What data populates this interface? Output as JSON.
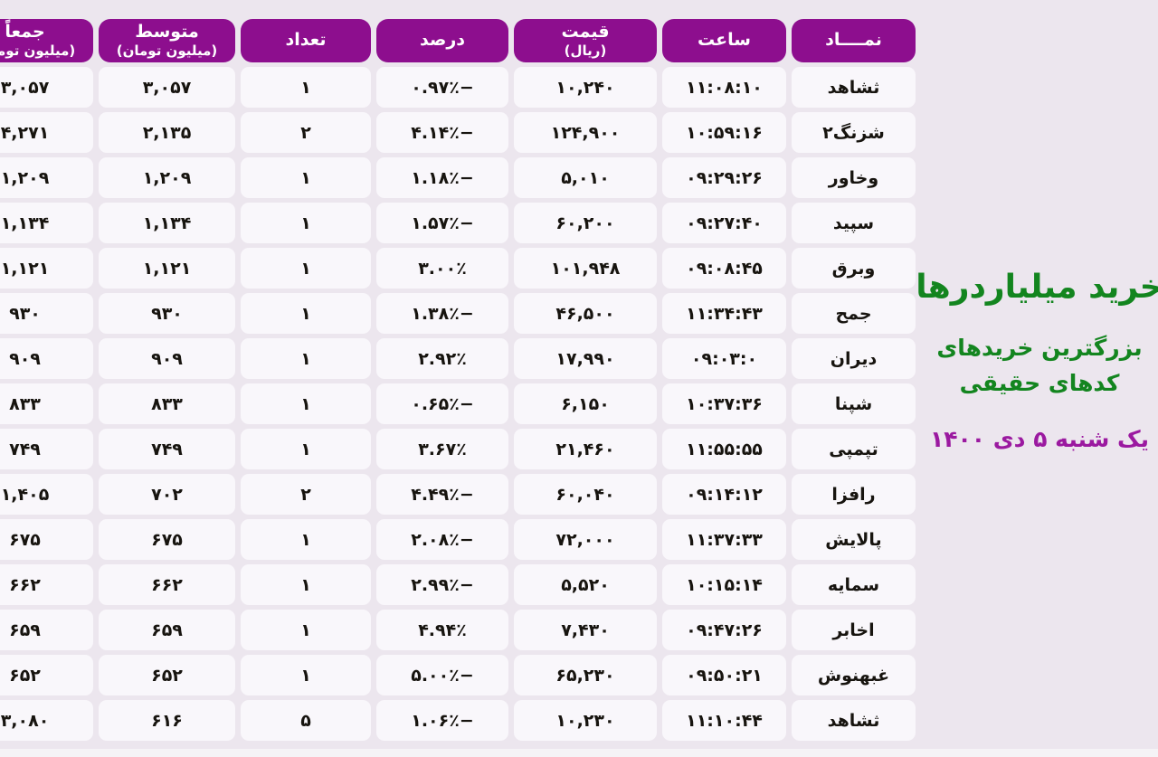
{
  "caption": {
    "title": "خرید میلیاردرها",
    "subtitle_line1": "بزرگترین خریدهای",
    "subtitle_line2": "کدهای حقیقی",
    "date": "یک شنبه ۵ دی ۱۴۰۰",
    "title_color": "#13851f",
    "subtitle_color": "#13851f",
    "date_color": "#9b19a0"
  },
  "theme": {
    "page_background": "#ece6ee",
    "header_background": "#8d0e8e",
    "header_text": "#ffffff",
    "cell_background": "#f9f7fb",
    "cell_text": "#17140f",
    "positive_color": "#17761d",
    "negative_color": "#e01b1b"
  },
  "table": {
    "headers": [
      {
        "main": "نمــــاد",
        "unit": ""
      },
      {
        "main": "ساعت",
        "unit": ""
      },
      {
        "main": "قیمت",
        "unit": "(ریال)"
      },
      {
        "main": "درصد",
        "unit": ""
      },
      {
        "main": "تعداد",
        "unit": ""
      },
      {
        "main": "متوسط",
        "unit": "(میلیون تومان)"
      },
      {
        "main": "جمعاً",
        "unit": "(میلیون تومان)"
      }
    ],
    "rows": [
      {
        "symbol": "ثشاهد",
        "time": "۱۱:۰۸:۱۰",
        "price": "۱۰,۲۴۰",
        "percent": "−۰.۹۷٪",
        "sign": "neg",
        "count": "۱",
        "average": "۳,۰۵۷",
        "total": "۳,۰۵۷"
      },
      {
        "symbol": "شزنگ۲",
        "time": "۱۰:۵۹:۱۶",
        "price": "۱۲۴,۹۰۰",
        "percent": "−۴.۱۴٪",
        "sign": "neg",
        "count": "۲",
        "average": "۲,۱۳۵",
        "total": "۴,۲۷۱"
      },
      {
        "symbol": "وخاور",
        "time": "۰۹:۲۹:۲۶",
        "price": "۵,۰۱۰",
        "percent": "−۱.۱۸٪",
        "sign": "neg",
        "count": "۱",
        "average": "۱,۲۰۹",
        "total": "۱,۲۰۹"
      },
      {
        "symbol": "سپید",
        "time": "۰۹:۲۷:۴۰",
        "price": "۶۰,۲۰۰",
        "percent": "−۱.۵۷٪",
        "sign": "neg",
        "count": "۱",
        "average": "۱,۱۳۴",
        "total": "۱,۱۳۴"
      },
      {
        "symbol": "وبرق",
        "time": "۰۹:۰۸:۴۵",
        "price": "۱۰۱,۹۴۸",
        "percent": "۳.۰۰٪",
        "sign": "pos",
        "count": "۱",
        "average": "۱,۱۲۱",
        "total": "۱,۱۲۱"
      },
      {
        "symbol": "جمح",
        "time": "۱۱:۳۴:۴۳",
        "price": "۴۶,۵۰۰",
        "percent": "−۱.۳۸٪",
        "sign": "neg",
        "count": "۱",
        "average": "۹۳۰",
        "total": "۹۳۰"
      },
      {
        "symbol": "دیران",
        "time": "۰۹:۰۳:۰",
        "price": "۱۷,۹۹۰",
        "percent": "۲.۹۲٪",
        "sign": "pos",
        "count": "۱",
        "average": "۹۰۹",
        "total": "۹۰۹"
      },
      {
        "symbol": "شپنا",
        "time": "۱۰:۳۷:۳۶",
        "price": "۶,۱۵۰",
        "percent": "−۰.۶۵٪",
        "sign": "neg",
        "count": "۱",
        "average": "۸۳۳",
        "total": "۸۳۳"
      },
      {
        "symbol": "تپمپی",
        "time": "۱۱:۵۵:۵۵",
        "price": "۲۱,۴۶۰",
        "percent": "۳.۶۷٪",
        "sign": "pos",
        "count": "۱",
        "average": "۷۴۹",
        "total": "۷۴۹"
      },
      {
        "symbol": "رافزا",
        "time": "۰۹:۱۴:۱۲",
        "price": "۶۰,۰۴۰",
        "percent": "−۴.۴۹٪",
        "sign": "neg",
        "count": "۲",
        "average": "۷۰۲",
        "total": "۱,۴۰۵"
      },
      {
        "symbol": "پالایش",
        "time": "۱۱:۳۷:۳۳",
        "price": "۷۲,۰۰۰",
        "percent": "−۲.۰۸٪",
        "sign": "neg",
        "count": "۱",
        "average": "۶۷۵",
        "total": "۶۷۵"
      },
      {
        "symbol": "سمایه",
        "time": "۱۰:۱۵:۱۴",
        "price": "۵,۵۲۰",
        "percent": "−۲.۹۹٪",
        "sign": "neg",
        "count": "۱",
        "average": "۶۶۲",
        "total": "۶۶۲"
      },
      {
        "symbol": "اخابر",
        "time": "۰۹:۴۷:۲۶",
        "price": "۷,۴۳۰",
        "percent": "۴.۹۴٪",
        "sign": "pos",
        "count": "۱",
        "average": "۶۵۹",
        "total": "۶۵۹"
      },
      {
        "symbol": "غبهنوش",
        "time": "۰۹:۵۰:۲۱",
        "price": "۶۵,۲۳۰",
        "percent": "−۵.۰۰٪",
        "sign": "neg",
        "count": "۱",
        "average": "۶۵۲",
        "total": "۶۵۲"
      },
      {
        "symbol": "ثشاهد",
        "time": "۱۱:۱۰:۴۴",
        "price": "۱۰,۲۳۰",
        "percent": "−۱.۰۶٪",
        "sign": "neg",
        "count": "۵",
        "average": "۶۱۶",
        "total": "۳,۰۸۰"
      }
    ]
  }
}
